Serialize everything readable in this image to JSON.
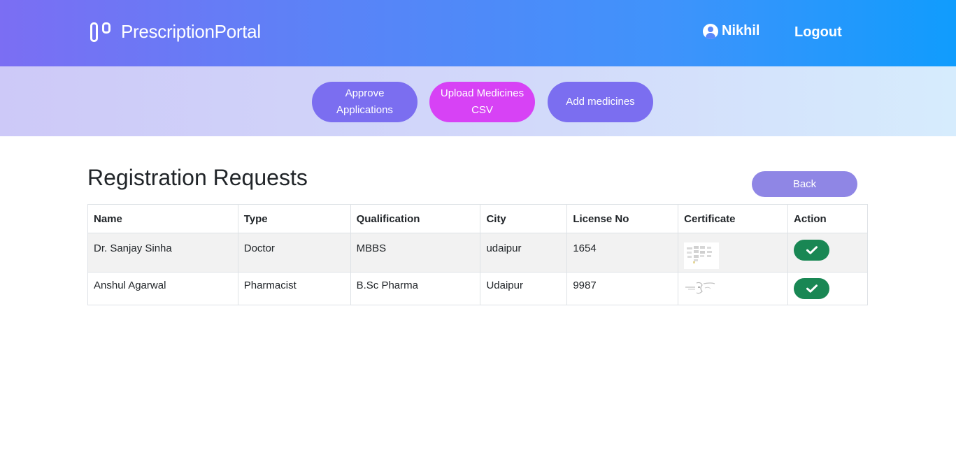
{
  "header": {
    "brand": "PrescriptionPortal",
    "brand_icon": "columns-logo-icon",
    "user_name": "Nikhil",
    "user_icon": "user-circle-icon",
    "logout_label": "Logout",
    "gradient_start": "#7b6ef3",
    "gradient_end": "#109cfd"
  },
  "subnav": {
    "buttons": [
      {
        "label": "Approve Applications",
        "color": "#7b6ef0"
      },
      {
        "label": "Upload Medicines CSV",
        "color": "#d742f5"
      },
      {
        "label": "Add medicines",
        "color": "#7b6ef0"
      }
    ]
  },
  "main": {
    "title": "Registration Requests",
    "back_label": "Back",
    "table": {
      "columns": [
        "Name",
        "Type",
        "Qualification",
        "City",
        "License No",
        "Certificate",
        "Action"
      ],
      "rows": [
        {
          "name": "Dr. Sanjay Sinha",
          "type": "Doctor",
          "qualification": "MBBS",
          "city": "udaipur",
          "license_no": "1654",
          "certificate": "certificate-thumbnail",
          "action": "check-icon"
        },
        {
          "name": "Anshul Agarwal",
          "type": "Pharmacist",
          "qualification": "B.Sc Pharma",
          "city": "Udaipur",
          "license_no": "9987",
          "certificate": "certificate-thumbnail",
          "action": "check-icon"
        }
      ]
    },
    "approve_color": "#198754"
  }
}
